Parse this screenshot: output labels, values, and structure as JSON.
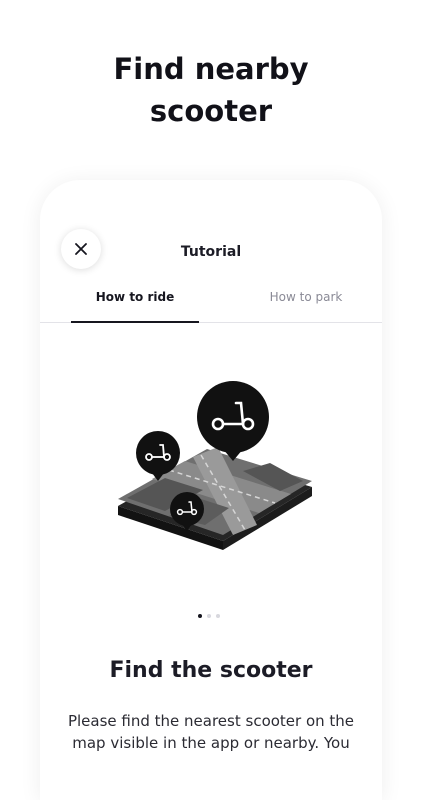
{
  "promo": {
    "title": "Find nearby\nscooter"
  },
  "screen": {
    "title": "Tutorial",
    "close_icon": "close-icon"
  },
  "tabs": [
    {
      "label": "How to ride",
      "active": true
    },
    {
      "label": "How to park",
      "active": false
    }
  ],
  "slide": {
    "heading": "Find the scooter",
    "body": "Please find the nearest scooter on the map visible in the app or nearby. You",
    "current_index": 1,
    "total": 3
  },
  "colors": {
    "accent": "#16161f",
    "inactive_tab": "#8a8a96",
    "divider": "#e3e3e8"
  }
}
